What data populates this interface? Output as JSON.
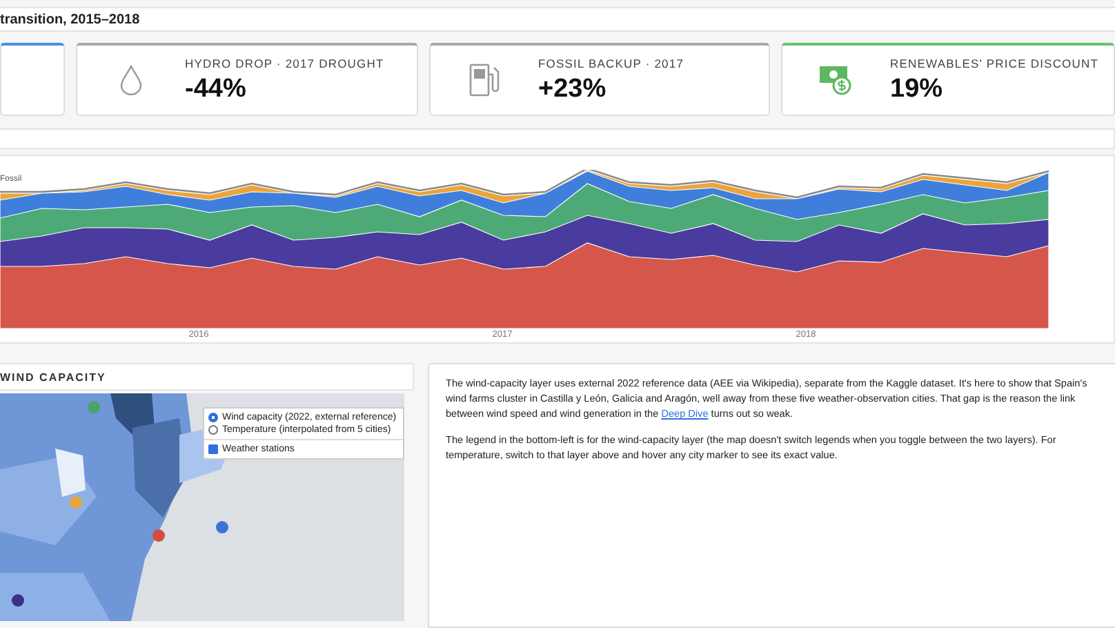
{
  "header": {
    "title": "transition, 2015–2018"
  },
  "kpis": [
    {
      "color": "#4a8fe0"
    },
    {
      "color": "#a8a8a8",
      "kind": "drop",
      "label": "HYDRO DROP · 2017 DROUGHT",
      "value": "-44%"
    },
    {
      "color": "#a8a8a8",
      "kind": "fuel",
      "label": "FOSSIL BACKUP · 2017",
      "value": "+23%"
    },
    {
      "color": "#6cc070",
      "kind": "money",
      "label": "RENEWABLES' PRICE DISCOUNT",
      "value": "19%"
    }
  ],
  "chart": {
    "legend": [
      "Fossil"
    ],
    "x_labels": [
      "2016",
      "2017",
      "2018"
    ]
  },
  "map_section": {
    "title": "WIND CAPACITY",
    "layers": [
      {
        "label": "Wind capacity (2022, external reference)",
        "selected": true
      },
      {
        "label": "Temperature (interpolated from 5 cities)",
        "selected": false
      }
    ],
    "overlays": [
      {
        "label": "Weather stations",
        "checked": true
      }
    ]
  },
  "notes": [
    {
      "before": "The wind-capacity layer uses external 2022 reference data (AEE via Wikipedia), separate from the Kaggle dataset. It's here to show that Spain's wind farms cluster in Castilla y León, Galicia and Aragón, well away from these five weather-observation cities. That gap is the reason the link between wind speed and wind generation in the ",
      "link": "Deep Dive",
      "after": " turns out so weak."
    },
    {
      "before": "The legend in the bottom-left is for the wind-capacity layer (the map doesn't switch legends when you toggle between the two layers). For temperature, switch to that layer above and hover any city marker to see its exact value."
    }
  ]
}
